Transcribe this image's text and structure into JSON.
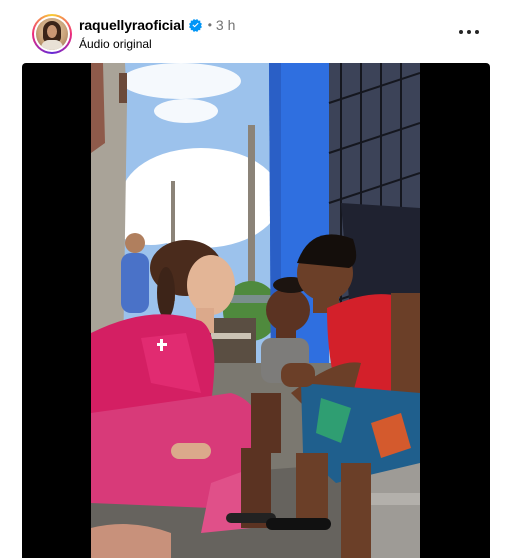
{
  "post": {
    "username": "raquellyraoficial",
    "verified": true,
    "separator": "•",
    "time": "3 h",
    "audio_label": "Áudio original"
  },
  "icons": {
    "verified": "verified-badge-icon",
    "more": "more-options-icon"
  },
  "colors": {
    "verified_blue": "#0095f6",
    "secondary_text": "#737373",
    "media_background": "#000000"
  }
}
